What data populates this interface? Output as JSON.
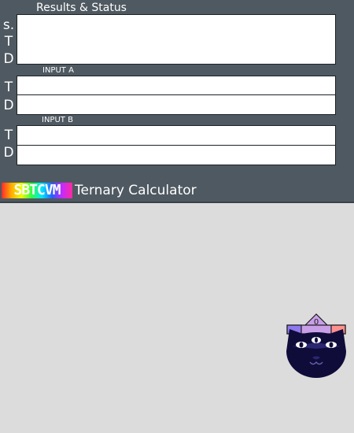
{
  "results": {
    "title": "Results & Status",
    "side_labels": [
      "s.",
      "T",
      "D"
    ],
    "output_value": ""
  },
  "input_a": {
    "label": "INPUT A",
    "ternary_label": "T",
    "decimal_label": "D",
    "ternary_value": "",
    "decimal_value": ""
  },
  "input_b": {
    "label": "INPUT B",
    "ternary_label": "T",
    "decimal_label": "D",
    "ternary_value": "",
    "decimal_value": ""
  },
  "brand": {
    "logo_text": "SBTCVM",
    "title": "Ternary Calculator"
  },
  "mascot": {
    "icon": "cat-mascot-icon",
    "glyph": "0"
  },
  "colors": {
    "panel": "#4f5961",
    "background": "#dcdcdc",
    "mascot_body": "#0f0c3a",
    "mascot_hat": "#c9a0e8"
  }
}
